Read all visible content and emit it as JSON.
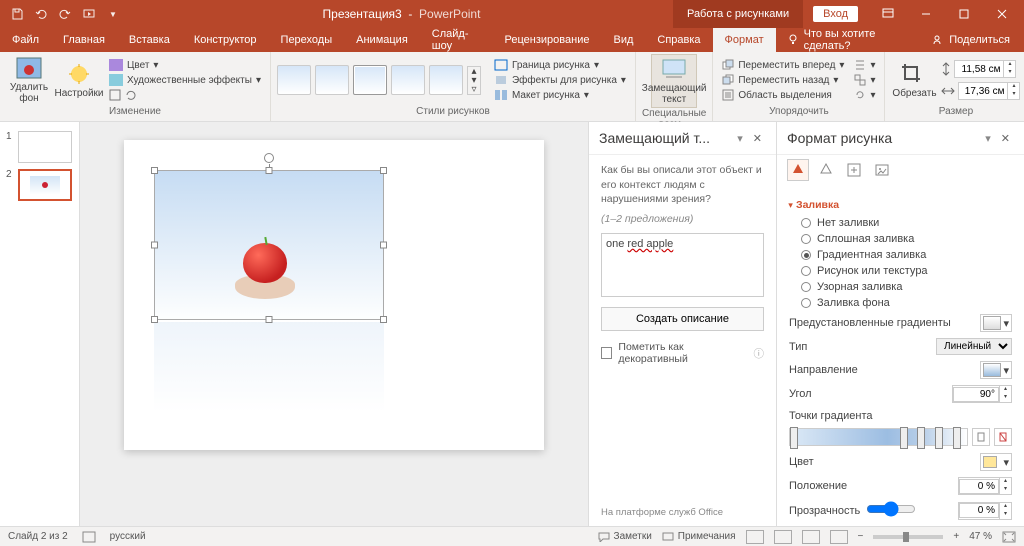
{
  "titlebar": {
    "doc_title": "Презентация3",
    "app_name": "PowerPoint",
    "contextual_group": "Работа с рисунками",
    "login": "Вход"
  },
  "tabs": {
    "file": "Файл",
    "home": "Главная",
    "insert": "Вставка",
    "design": "Конструктор",
    "transitions": "Переходы",
    "animations": "Анимация",
    "slideshow": "Слайд-шоу",
    "review": "Рецензирование",
    "view": "Вид",
    "help": "Справка",
    "format": "Формат",
    "tell_me": "Что вы хотите сделать?",
    "share": "Поделиться"
  },
  "ribbon": {
    "remove_bg": "Удалить фон",
    "adjustments": "Настройки",
    "color": "Цвет",
    "artistic": "Художественные эффекты",
    "group_change": "Изменение",
    "group_styles": "Стили рисунков",
    "border": "Граница рисунка",
    "effects": "Эффекты для рисунка",
    "layout": "Макет рисунка",
    "alt_text_btn": "Замещающий текст",
    "group_access": "Специальные возм...",
    "bring_forward": "Переместить вперед",
    "send_backward": "Переместить назад",
    "selection_pane": "Область выделения",
    "group_arrange": "Упорядочить",
    "crop": "Обрезать",
    "height": "11,58 см",
    "width": "17,36 см",
    "group_size": "Размер"
  },
  "thumbs": [
    "1",
    "2"
  ],
  "alt_pane": {
    "title": "Замещающий т...",
    "desc": "Как бы вы описали этот объект и его контекст людям с нарушениями зрения?",
    "hint": "(1–2 предложения)",
    "text_prefix": "one ",
    "text_misspell": "red apple",
    "generate": "Создать описание",
    "decorative": "Пометить как декоративный",
    "platform": "На платформе служб Office"
  },
  "format_pane": {
    "title": "Формат рисунка",
    "section_fill": "Заливка",
    "fill_options": {
      "none": "Нет заливки",
      "solid": "Сплошная заливка",
      "gradient": "Градиентная заливка",
      "picture": "Рисунок или текстура",
      "pattern": "Узорная заливка",
      "background": "Заливка фона"
    },
    "preset_gradients": "Предустановленные градиенты",
    "type": "Тип",
    "type_value": "Линейный",
    "direction": "Направление",
    "angle": "Угол",
    "angle_value": "90°",
    "grad_stops": "Точки градиента",
    "color": "Цвет",
    "position": "Положение",
    "position_value": "0 %",
    "transparency": "Прозрачность",
    "transparency_value": "0 %"
  },
  "status": {
    "slide": "Слайд 2 из 2",
    "lang": "русский",
    "notes": "Заметки",
    "comments": "Примечания",
    "zoom": "47 %"
  }
}
